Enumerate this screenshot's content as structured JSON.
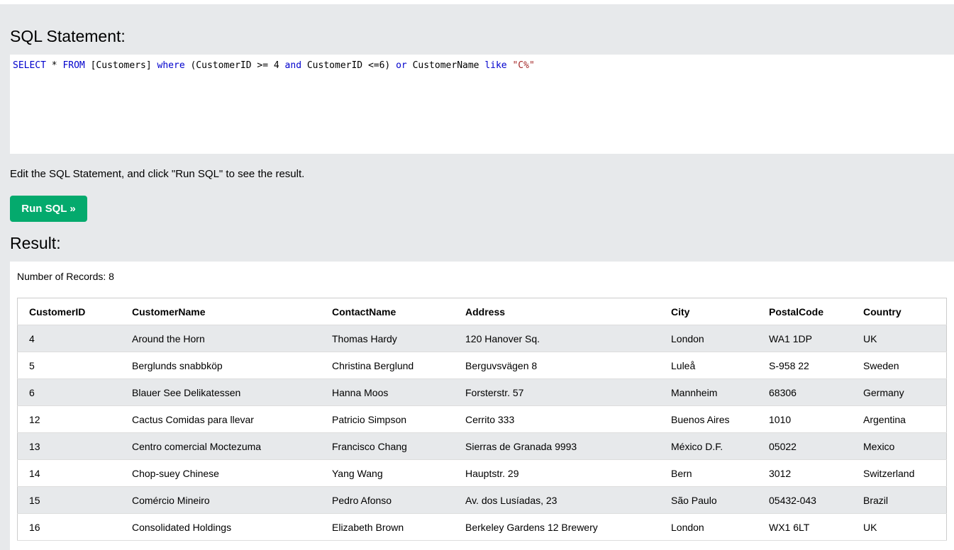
{
  "editor": {
    "title": "SQL Statement:",
    "tokens": {
      "t1": "SELECT",
      "t2": " * ",
      "t3": "FROM",
      "t4": " [Customers] ",
      "t5": "where",
      "t6": " (CustomerID >= 4 ",
      "t7": "and",
      "t8": " CustomerID <=6) ",
      "t9": "or",
      "t10": " CustomerName ",
      "t11": "like",
      "t12": " ",
      "t13": "\"C%\""
    },
    "hint": "Edit the SQL Statement, and click \"Run SQL\" to see the result.",
    "run_label": "Run SQL »"
  },
  "result": {
    "title": "Result:",
    "record_count": "Number of Records: 8",
    "columns": [
      "CustomerID",
      "CustomerName",
      "ContactName",
      "Address",
      "City",
      "PostalCode",
      "Country"
    ],
    "rows": [
      [
        "4",
        "Around the Horn",
        "Thomas Hardy",
        "120 Hanover Sq.",
        "London",
        "WA1 1DP",
        "UK"
      ],
      [
        "5",
        "Berglunds snabbköp",
        "Christina Berglund",
        "Berguvsvägen 8",
        "Luleå",
        "S-958 22",
        "Sweden"
      ],
      [
        "6",
        "Blauer See Delikatessen",
        "Hanna Moos",
        "Forsterstr. 57",
        "Mannheim",
        "68306",
        "Germany"
      ],
      [
        "12",
        "Cactus Comidas para llevar",
        "Patricio Simpson",
        "Cerrito 333",
        "Buenos Aires",
        "1010",
        "Argentina"
      ],
      [
        "13",
        "Centro comercial Moctezuma",
        "Francisco Chang",
        "Sierras de Granada 9993",
        "México D.F.",
        "05022",
        "Mexico"
      ],
      [
        "14",
        "Chop-suey Chinese",
        "Yang Wang",
        "Hauptstr. 29",
        "Bern",
        "3012",
        "Switzerland"
      ],
      [
        "15",
        "Comércio Mineiro",
        "Pedro Afonso",
        "Av. dos Lusíadas, 23",
        "São Paulo",
        "05432-043",
        "Brazil"
      ],
      [
        "16",
        "Consolidated Holdings",
        "Elizabeth Brown",
        "Berkeley Gardens 12 Brewery",
        "London",
        "WX1 6LT",
        "UK"
      ]
    ]
  },
  "colors": {
    "panel_bg": "#e7e9eb",
    "button_bg": "#04aa6d",
    "keyword": "#0000cd",
    "string": "#a52a2a"
  }
}
